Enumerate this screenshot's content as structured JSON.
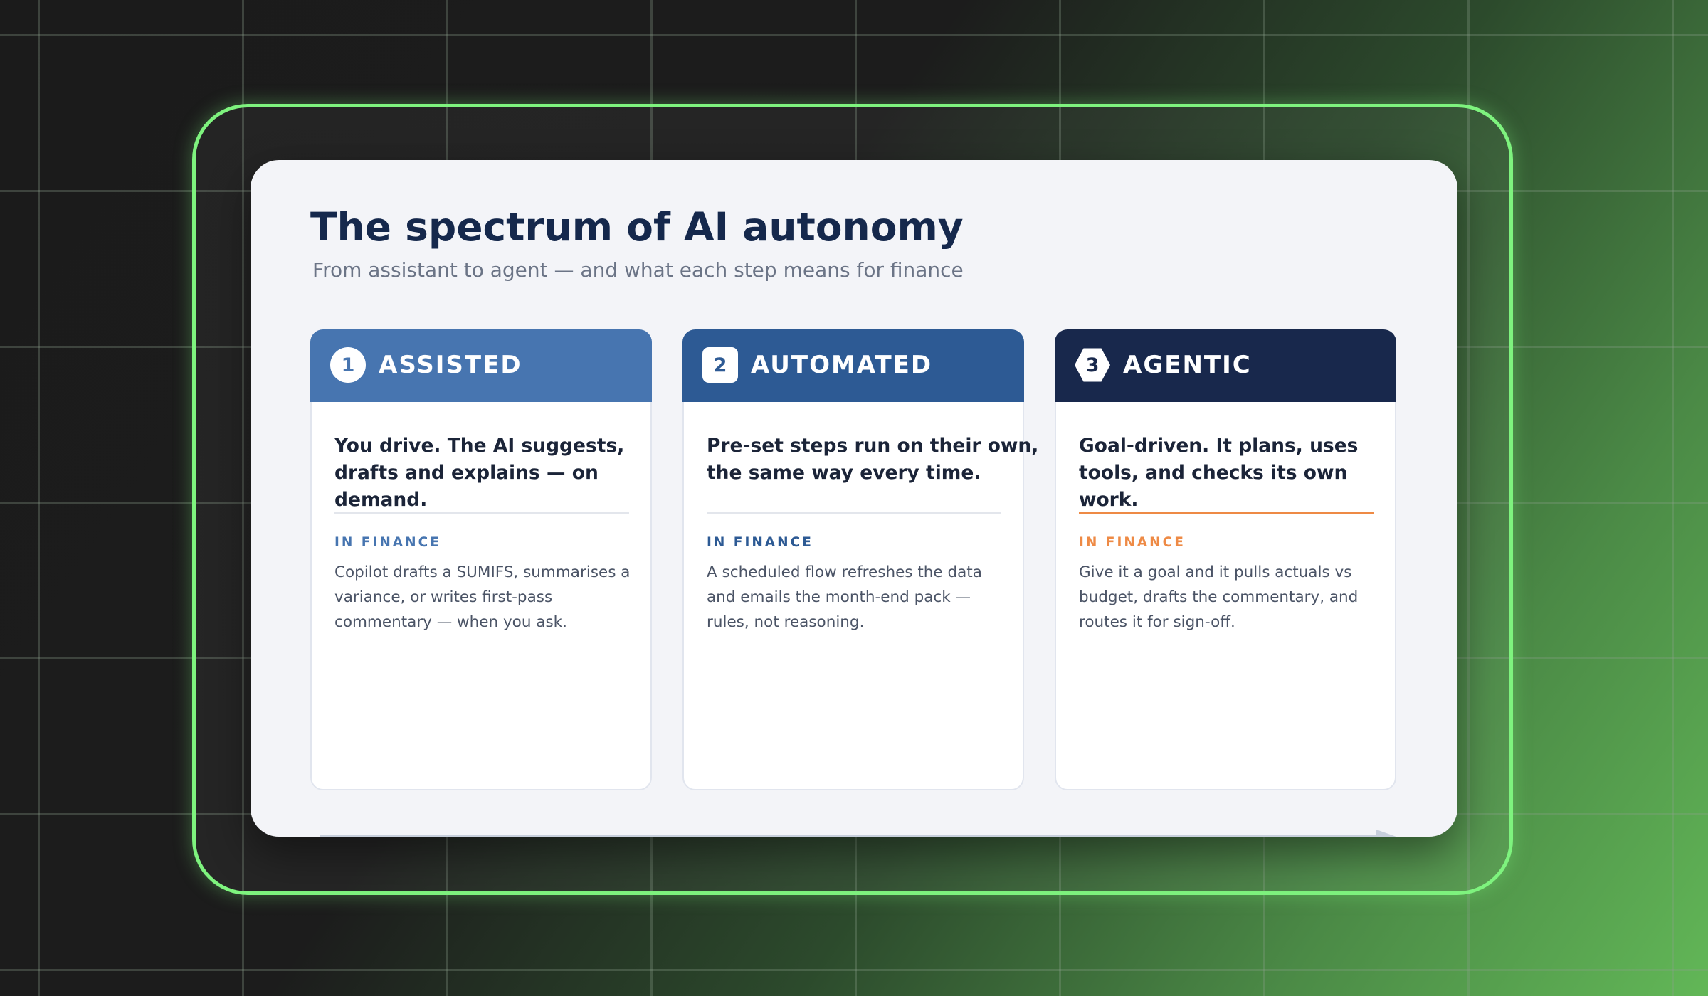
{
  "header": {
    "title": "The spectrum of AI autonomy",
    "subtitle": "From assistant to agent — and what each step means for finance"
  },
  "colors": {
    "frame_border": "#7ef37e",
    "stage1": "#4775b0",
    "stage2": "#2d5a94",
    "stage3": "#18284c",
    "accent_orange": "#ee8a45",
    "title_text": "#15284c"
  },
  "stages": [
    {
      "number": "1",
      "badge_icon": "circle-badge-icon",
      "name": "ASSISTED",
      "lead": "You drive. The AI suggests, drafts and explains — on demand.",
      "kicker": "IN FINANCE",
      "body": "Copilot drafts a SUMIFS, summarises a variance, or writes first-pass commentary — when you ask."
    },
    {
      "number": "2",
      "badge_icon": "square-badge-icon",
      "name": "AUTOMATED",
      "lead": "Pre-set steps run on their own, the same way every time.",
      "kicker": "IN FINANCE",
      "body": "A scheduled flow refreshes the data and emails the month-end pack — rules, not reasoning."
    },
    {
      "number": "3",
      "badge_icon": "hexagon-badge-icon",
      "name": "AGENTIC",
      "lead": "Goal-driven. It plans, uses tools, and checks its own work.",
      "kicker": "IN FINANCE",
      "body": "Give it a goal and it pulls actuals vs budget, drafts the commentary, and routes it for sign-off."
    }
  ],
  "arrow_icon": "arrow-right-icon"
}
